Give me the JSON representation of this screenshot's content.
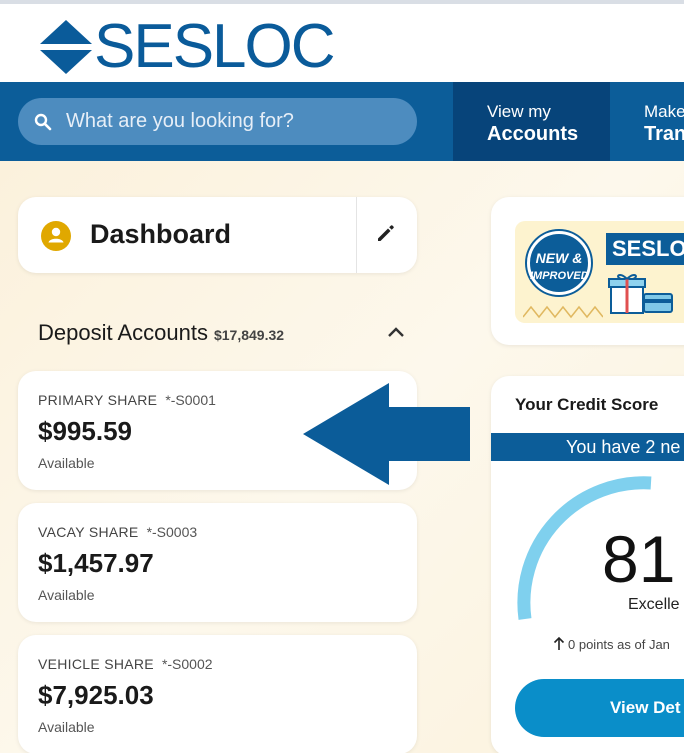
{
  "brand": {
    "name": "SESLOC",
    "color": "#0a5b9a"
  },
  "search": {
    "placeholder": "What are you looking for?",
    "icon": "search-icon"
  },
  "nav": {
    "tabs": [
      {
        "line1": "View my",
        "line2": "Accounts",
        "active": true
      },
      {
        "line1": "Make",
        "line2": "Tran"
      }
    ]
  },
  "dashboard": {
    "title": "Dashboard",
    "icon": "user-icon",
    "edit_icon": "pencil-icon"
  },
  "deposit": {
    "title": "Deposit Accounts",
    "total": "$17,849.32",
    "accounts": [
      {
        "name": "PRIMARY SHARE",
        "number": "*-S0001",
        "balance": "$995.59",
        "label": "Available"
      },
      {
        "name": "VACAY SHARE",
        "number": "*-S0003",
        "balance": "$1,457.97",
        "label": "Available"
      },
      {
        "name": "VEHICLE SHARE",
        "number": "*-S0002",
        "balance": "$7,925.03",
        "label": "Available"
      }
    ]
  },
  "promo": {
    "badge_line1": "NEW &",
    "badge_line2": "IMPROVED",
    "brand_text": "SESLO"
  },
  "credit": {
    "title": "Your Credit Score",
    "banner": "You have 2 ne",
    "score": "81",
    "score_label": "Excelle",
    "points": "0 points as of Jan",
    "button": "View Det"
  },
  "colors": {
    "primary": "#0c5d99",
    "primary_dark": "#07447a",
    "accent": "#0a8ec9",
    "gauge": "#7fd0ee",
    "user_icon": "#e0a800"
  }
}
